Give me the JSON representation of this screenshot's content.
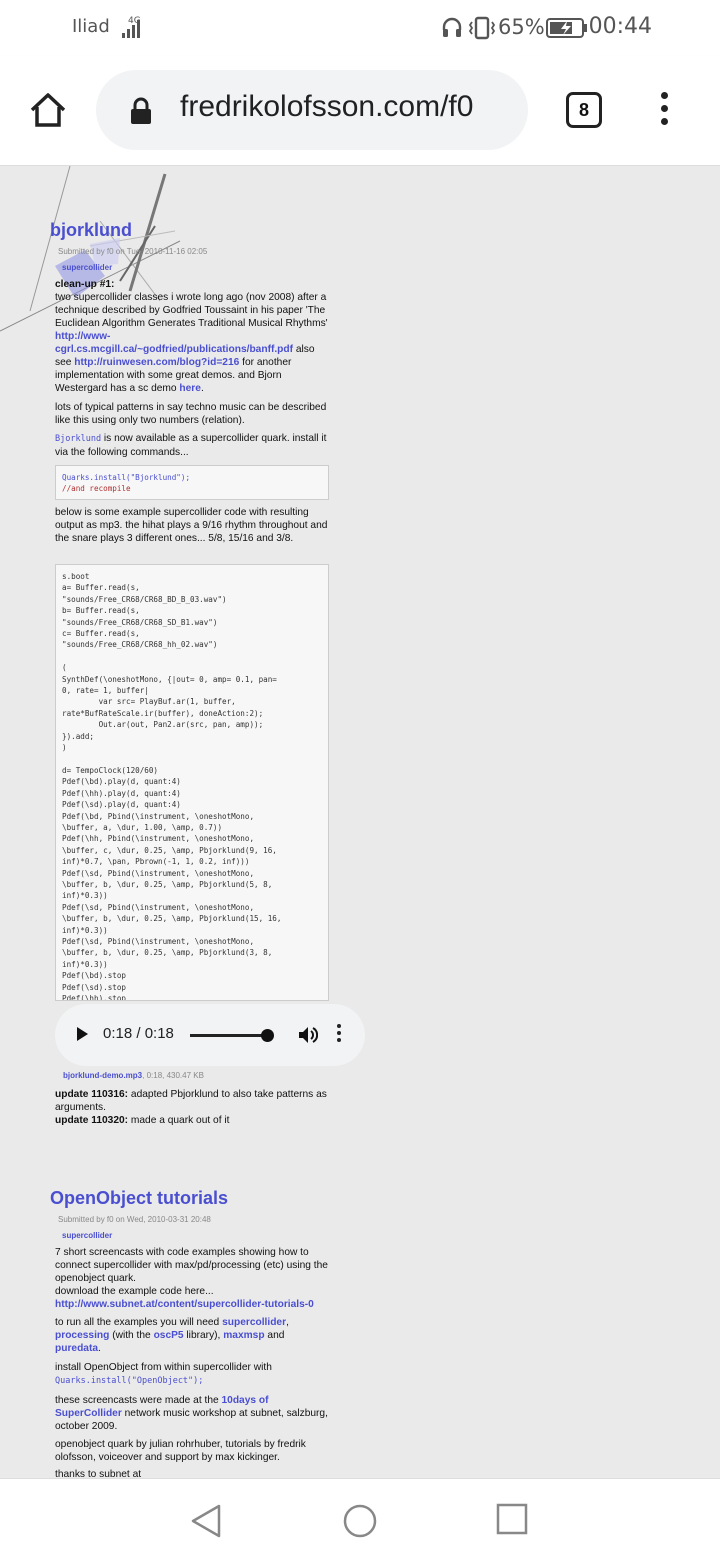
{
  "status_bar": {
    "carrier": "Iliad",
    "network": "4G",
    "battery": "65%",
    "time": "00:44"
  },
  "browser": {
    "url": "fredrikolofsson.com/f0",
    "tab_count": "8"
  },
  "posts": [
    {
      "title": "bjorklund",
      "meta": "Submitted by f0 on Tue, 2010-11-16 02:05",
      "tag": "supercollider",
      "heading": "clean-up #1:",
      "p1": "two supercollider classes i wrote long ago (nov 2008) after a technique described by Godfried Toussaint in his paper 'The Euclidean Algorithm Generates Traditional Musical Rhythms'",
      "link1": "http://www-cgrl.cs.mcgill.ca/~godfried/publications/banff.pdf",
      "p1b": "also see",
      "link2": "http://ruinwesen.com/blog?id=216",
      "p1c": "for another implementation with some great demos. and Bjorn Westergard has a sc demo",
      "link3": "here",
      "p2": "lots of typical patterns in say techno music can be described like this using only two numbers (relation).",
      "p3_code": "Bjorklund",
      "p3": "is now available as a supercollider quark. install it via the following commands...",
      "code1_line1": "Quarks.install(\"Bjorklund\");",
      "code1_line2": "//and recompile",
      "p4": "below is some example supercollider code with resulting output as mp3. the hihat plays a 9/16 rhythm throughout and the snare plays 3 different ones... 5/8, 15/16 and 3/8.",
      "code2": [
        "s.boot",
        "a= Buffer.read(s,",
        "\"sounds/Free_CR68/CR68_BD_B_03.wav\")",
        "b= Buffer.read(s,",
        "\"sounds/Free_CR68/CR68_SD_B1.wav\")",
        "c= Buffer.read(s,",
        "\"sounds/Free_CR68/CR68_hh_02.wav\")",
        "",
        "(",
        "SynthDef(\\oneshotMono, {|out= 0, amp= 0.1, pan=",
        "0, rate= 1, buffer|",
        "        var src= PlayBuf.ar(1, buffer,",
        "rate*BufRateScale.ir(buffer), doneAction:2);",
        "        Out.ar(out, Pan2.ar(src, pan, amp));",
        "}).add;",
        ")",
        "",
        "d= TempoClock(120/60)",
        "Pdef(\\bd).play(d, quant:4)",
        "Pdef(\\hh).play(d, quant:4)",
        "Pdef(\\sd).play(d, quant:4)",
        "Pdef(\\bd, Pbind(\\instrument, \\oneshotMono,",
        "\\buffer, a, \\dur, 1.00, \\amp, 0.7))",
        "Pdef(\\hh, Pbind(\\instrument, \\oneshotMono,",
        "\\buffer, c, \\dur, 0.25, \\amp, Pbjorklund(9, 16,",
        "inf)*0.7, \\pan, Pbrown(-1, 1, 0.2, inf)))",
        "Pdef(\\sd, Pbind(\\instrument, \\oneshotMono,",
        "\\buffer, b, \\dur, 0.25, \\amp, Pbjorklund(5, 8,",
        "inf)*0.3))",
        "Pdef(\\sd, Pbind(\\instrument, \\oneshotMono,",
        "\\buffer, b, \\dur, 0.25, \\amp, Pbjorklund(15, 16,",
        "inf)*0.3))",
        "Pdef(\\sd, Pbind(\\instrument, \\oneshotMono,",
        "\\buffer, b, \\dur, 0.25, \\amp, Pbjorklund(3, 8,",
        "inf)*0.3))",
        "Pdef(\\bd).stop",
        "Pdef(\\sd).stop",
        "Pdef(\\hh).stop"
      ],
      "player_time": "0:18 / 0:18",
      "player_progress": 1.0,
      "attachment_link": "bjorklund-demo.mp3",
      "attachment_info": ", 0:18, 430.47 KB",
      "update1_label": "update 110316:",
      "update1": "adapted Pbjorklund to also take patterns as arguments.",
      "update2_label": "update 110320:",
      "update2": "made a quark out of it"
    },
    {
      "title": "OpenObject tutorials",
      "meta": "Submitted by f0 on Wed, 2010-03-31 20:48",
      "tag": "supercollider",
      "p1": "7 short screencasts with code examples showing how to connect supercollider with max/pd/processing (etc) using the openobject quark.",
      "p1b": "download the example code here...",
      "link1": "http://www.subnet.at/content/supercollider-tutorials-0",
      "p2a": "to run all the examples you will need",
      "link_sc": "supercollider",
      "link_processing": "processing",
      "p2b": "(with the",
      "link_oscp5": "oscP5",
      "p2c": "library),",
      "link_maxmsp": "maxmsp",
      "p2d": "and",
      "link_puredata": "puredata",
      "p3a": "install OpenObject from within supercollider with",
      "p3_code": "Quarks.install(\"OpenObject\");",
      "p4a": "these screencasts were made at the",
      "link_10days": "10days of SuperCollider",
      "p4b": "network music workshop at subnet, salzburg, october 2009.",
      "p5": "openobject quark by julian rohrhuber, tutorials by fredrik olofsson, voiceover and support by max kickinger.",
      "p6": "thanks to subnet at"
    }
  ],
  "icons": {
    "home": "home-icon",
    "lock": "lock-icon",
    "menu": "more-vert-icon",
    "back": "nav-back-icon",
    "home_nav": "nav-home-icon",
    "recents": "nav-recents-icon"
  }
}
